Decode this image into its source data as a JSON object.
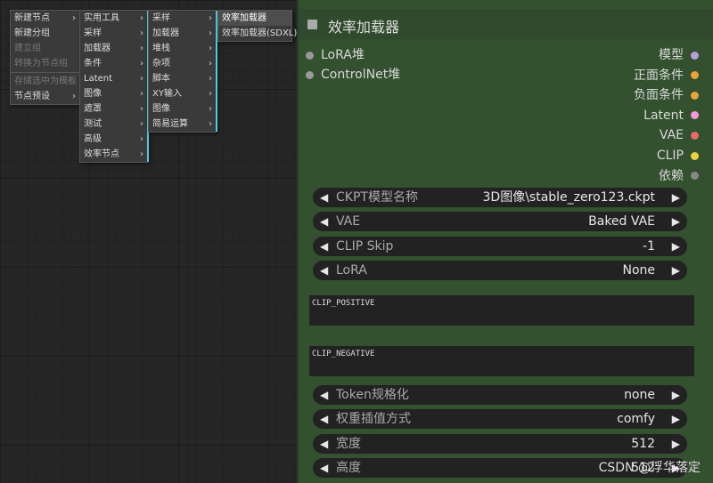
{
  "menu_main": [
    {
      "label": "新建节点",
      "arrow": "›"
    },
    {
      "label": "新建分组"
    },
    {
      "label": "建立组",
      "disabled": true
    },
    {
      "label": "转换为节点组",
      "disabled": true
    },
    {
      "sep": true
    },
    {
      "label": "存储选中为模板",
      "disabled": true
    },
    {
      "label": "节点预设",
      "arrow": "›"
    }
  ],
  "menu_category": [
    {
      "label": "实用工具",
      "arrow": "›"
    },
    {
      "label": "采样",
      "arrow": "›"
    },
    {
      "label": "加载器",
      "arrow": "›"
    },
    {
      "label": "条件",
      "arrow": "›"
    },
    {
      "label": "Latent",
      "arrow": "›"
    },
    {
      "label": "图像",
      "arrow": "›"
    },
    {
      "label": "遮罩",
      "arrow": "›"
    },
    {
      "label": "测试",
      "arrow": "›"
    },
    {
      "label": "高级",
      "arrow": "›"
    },
    {
      "label": "效率节点",
      "arrow": "›"
    }
  ],
  "menu_efficiency": [
    {
      "label": "采样",
      "arrow": "›"
    },
    {
      "label": "加载器",
      "arrow": "›"
    },
    {
      "label": "堆栈",
      "arrow": "›"
    },
    {
      "label": "杂项",
      "arrow": "›"
    },
    {
      "label": "脚本",
      "arrow": "›"
    },
    {
      "label": "XY输入",
      "arrow": "›"
    },
    {
      "label": "图像",
      "arrow": "›"
    },
    {
      "label": "简易运算",
      "arrow": "›"
    }
  ],
  "menu_loaders": [
    {
      "label": "效率加载器",
      "selected": true
    },
    {
      "label": "效率加载器(SDXL)"
    }
  ],
  "node": {
    "title": "效率加载器",
    "inputs": [
      {
        "label": "LoRA堆"
      },
      {
        "label": "ControlNet堆"
      }
    ],
    "outputs": [
      {
        "label": "模型",
        "color": "#b79fd8"
      },
      {
        "label": "正面条件",
        "color": "#e8a33a"
      },
      {
        "label": "负面条件",
        "color": "#e8a33a"
      },
      {
        "label": "Latent",
        "color": "#f09ad8"
      },
      {
        "label": "VAE",
        "color": "#e86a6a"
      },
      {
        "label": "CLIP",
        "color": "#e8d240"
      },
      {
        "label": "依赖",
        "color": "#888"
      }
    ],
    "widgets_top": [
      {
        "name": "CKPT模型名称",
        "value": "3D图像\\stable_zero123.ckpt"
      },
      {
        "name": "VAE",
        "value": "Baked VAE"
      },
      {
        "name": "CLIP Skip",
        "value": "-1"
      },
      {
        "name": "LoRA",
        "value": "None"
      }
    ],
    "clip_positive": "CLIP_POSITIVE",
    "clip_negative": "CLIP_NEGATIVE",
    "widgets_bottom": [
      {
        "name": "Token规格化",
        "value": "none"
      },
      {
        "name": "权重插值方式",
        "value": "comfy"
      },
      {
        "name": "宽度",
        "value": "512"
      },
      {
        "name": "高度",
        "value": "512"
      }
    ]
  },
  "watermark": "CSDN @浮华落定",
  "arrows": {
    "left": "◀",
    "right": "▶"
  }
}
